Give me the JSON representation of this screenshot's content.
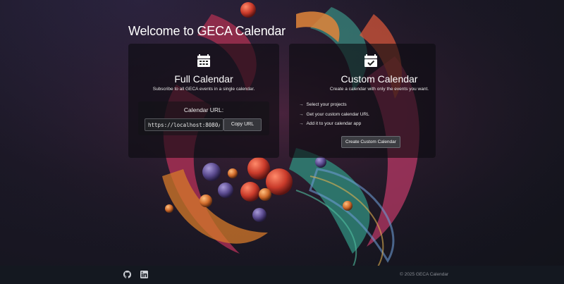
{
  "page": {
    "title": "Welcome to GECA Calendar"
  },
  "full_calendar": {
    "icon": "calendar-icon",
    "title": "Full Calendar",
    "subtitle": "Subscribe to all GECA events in a single calendar.",
    "url_label": "Calendar URL:",
    "url_value": "https://localhost:8080/",
    "copy_label": "Copy URL"
  },
  "custom_calendar": {
    "icon": "calendar-check-icon",
    "title": "Custom Calendar",
    "subtitle": "Create a calendar with only the events you want.",
    "steps": [
      "Select your projects",
      "Get your custom calendar URL",
      "Add it to your calendar app"
    ],
    "create_label": "Create Custom Calendar"
  },
  "footer": {
    "github_icon": "github-icon",
    "linkedin_icon": "linkedin-icon",
    "copyright": "© 2025 GECA Calendar"
  },
  "colors": {
    "panel_bg": "#0c0c10",
    "footer_bg": "#141820",
    "text": "#ffffff"
  }
}
